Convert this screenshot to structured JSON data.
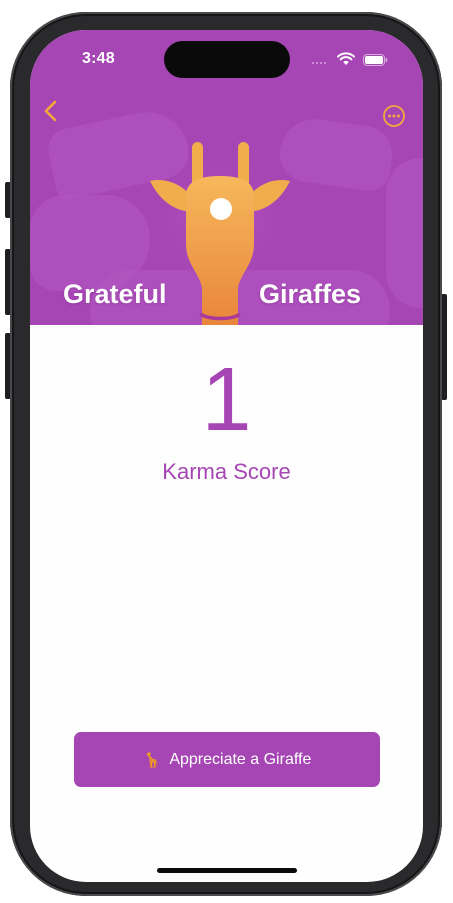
{
  "status_bar": {
    "time": "3:48",
    "icons": [
      "cellular-signal-icon",
      "wifi-icon",
      "battery-icon"
    ]
  },
  "nav": {
    "back_icon": "chevron-left-icon",
    "more_icon": "ellipsis-circle-icon"
  },
  "hero": {
    "title_left": "Grateful",
    "title_right": "Giraffes",
    "logo_icon": "giraffe-logo-icon"
  },
  "karma": {
    "score": "1",
    "label": "Karma Score"
  },
  "action": {
    "icon": "🦒",
    "label": "Appreciate a Giraffe"
  },
  "colors": {
    "brand_purple": "#a645b4",
    "accent_orange": "#f2a93b",
    "background": "#fefefe"
  }
}
